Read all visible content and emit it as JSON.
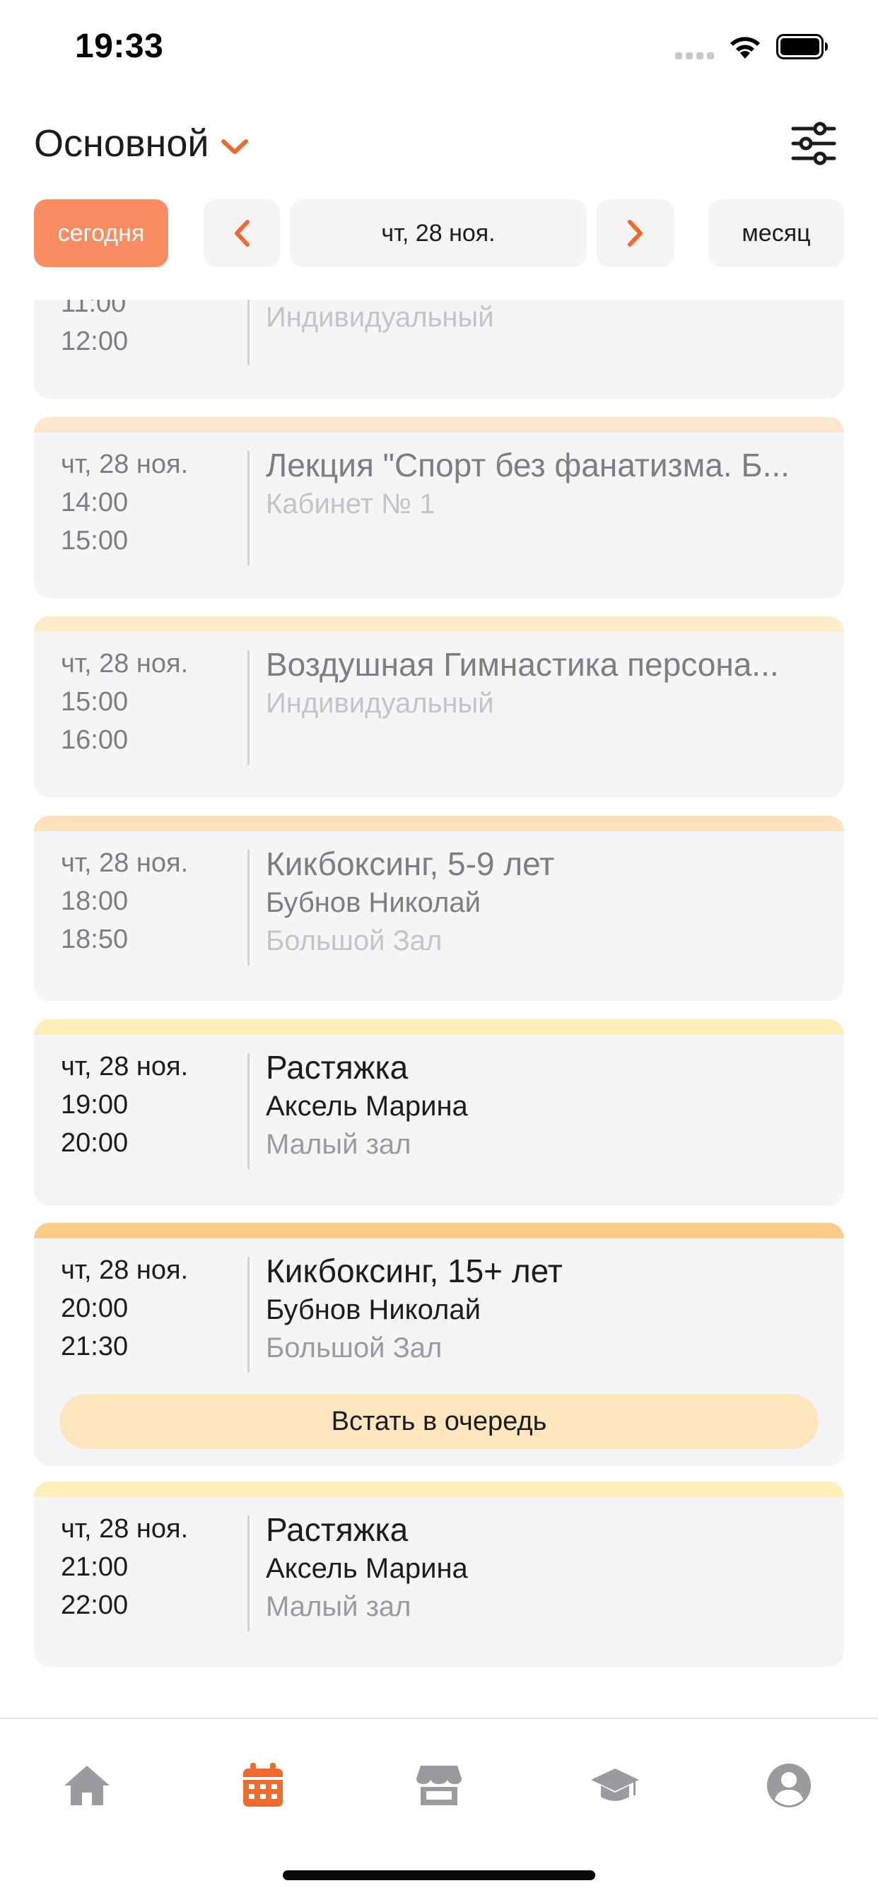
{
  "status_bar": {
    "time": "19:33",
    "icons": [
      "signal-icon",
      "wifi-icon",
      "battery-icon"
    ]
  },
  "header": {
    "title": "Основной",
    "dropdown_icon": "chevron-down-icon",
    "filter_icon": "sliders-icon"
  },
  "nav": {
    "today_label": "сегодня",
    "prev_icon": "chevron-left-icon",
    "date_label": "чт, 28 ноя.",
    "next_icon": "chevron-right-icon",
    "month_label": "месяц"
  },
  "events": [
    {
      "date": "",
      "start": "11:00",
      "end": "12:00",
      "title": "",
      "trainer": "",
      "room": "Индивидуальный",
      "state": "past"
    },
    {
      "date": "чт, 28 ноя.",
      "start": "14:00",
      "end": "15:00",
      "title": "Лекция \"Спорт без фанатизма. Б...",
      "trainer": "",
      "room": "Кабинет № 1",
      "state": "past",
      "stripe_color": "#fde6cf"
    },
    {
      "date": "чт, 28 ноя.",
      "start": "15:00",
      "end": "16:00",
      "title": "Воздушная Гимнастика персона...",
      "trainer": "",
      "room": "Индивидуальный",
      "state": "past",
      "stripe_color": "#fcedc8"
    },
    {
      "date": "чт, 28 ноя.",
      "start": "18:00",
      "end": "18:50",
      "title": "Кикбоксинг, 5-9 лет",
      "trainer": "Бубнов Николай",
      "room": "Большой Зал",
      "state": "past",
      "stripe_color": "#fde1bd"
    },
    {
      "date": "чт, 28 ноя.",
      "start": "19:00",
      "end": "20:00",
      "title": "Растяжка",
      "trainer": "Аксель Марина",
      "room": "Малый зал",
      "state": "upcoming",
      "stripe_color": "#fcefb7"
    },
    {
      "date": "чт, 28 ноя.",
      "start": "20:00",
      "end": "21:30",
      "title": "Кикбоксинг, 15+ лет",
      "trainer": "Бубнов Николай",
      "room": "Большой Зал",
      "state": "upcoming",
      "stripe_color": "#fdcc89",
      "action_label": "Встать в очередь"
    },
    {
      "date": "чт, 28 ноя.",
      "start": "21:00",
      "end": "22:00",
      "title": "Растяжка",
      "trainer": "Аксель Марина",
      "room": "Малый зал",
      "state": "upcoming",
      "stripe_color": "#fcefb7"
    }
  ],
  "tab_bar": {
    "tabs": [
      {
        "icon": "home-icon",
        "active": false
      },
      {
        "icon": "calendar-icon",
        "active": true
      },
      {
        "icon": "store-icon",
        "active": false
      },
      {
        "icon": "graduation-cap-icon",
        "active": false
      },
      {
        "icon": "profile-icon",
        "active": false
      }
    ]
  },
  "colors": {
    "accent": "#ef6a2c",
    "today_button": "#f98d62",
    "card_background": "#f5f5f7",
    "queue_button": "#fde5be",
    "inactive_tab": "#9b9b9f"
  }
}
